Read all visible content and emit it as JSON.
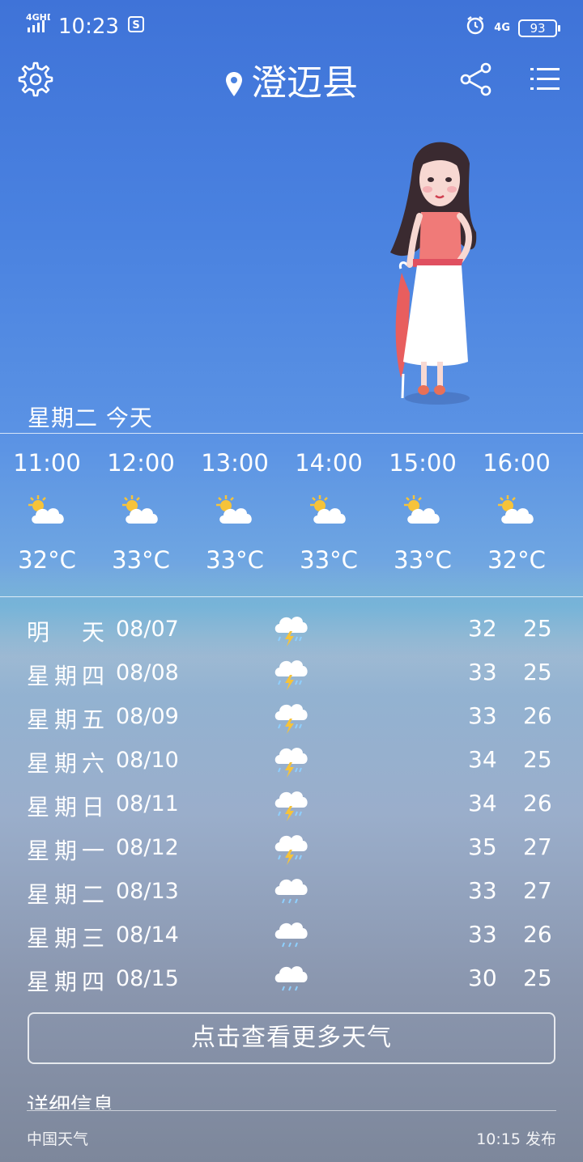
{
  "status_bar": {
    "network_label": "4GHD",
    "time": "10:23",
    "network_right": "4G",
    "battery": "93"
  },
  "header": {
    "city": "澄迈县"
  },
  "today_label": "星期二  今天",
  "hourly": [
    {
      "time": "11:00",
      "icon": "partly-cloudy-icon",
      "temp": "32°C"
    },
    {
      "time": "12:00",
      "icon": "partly-cloudy-icon",
      "temp": "33°C"
    },
    {
      "time": "13:00",
      "icon": "partly-cloudy-icon",
      "temp": "33°C"
    },
    {
      "time": "14:00",
      "icon": "partly-cloudy-icon",
      "temp": "33°C"
    },
    {
      "time": "15:00",
      "icon": "partly-cloudy-icon",
      "temp": "33°C"
    },
    {
      "time": "16:00",
      "icon": "partly-cloudy-icon",
      "temp": "32°C"
    }
  ],
  "daily": [
    {
      "day": "明天",
      "date": "08/07",
      "icon": "thunderstorm-icon",
      "high": "32",
      "low": "25"
    },
    {
      "day": "星期四",
      "date": "08/08",
      "icon": "thunderstorm-icon",
      "high": "33",
      "low": "25"
    },
    {
      "day": "星期五",
      "date": "08/09",
      "icon": "thunderstorm-icon",
      "high": "33",
      "low": "26"
    },
    {
      "day": "星期六",
      "date": "08/10",
      "icon": "thunderstorm-icon",
      "high": "34",
      "low": "25"
    },
    {
      "day": "星期日",
      "date": "08/11",
      "icon": "thunderstorm-icon",
      "high": "34",
      "low": "26"
    },
    {
      "day": "星期一",
      "date": "08/12",
      "icon": "thunderstorm-icon",
      "high": "35",
      "low": "27"
    },
    {
      "day": "星期二",
      "date": "08/13",
      "icon": "rain-icon",
      "high": "33",
      "low": "27"
    },
    {
      "day": "星期三",
      "date": "08/14",
      "icon": "rain-icon",
      "high": "33",
      "low": "26"
    },
    {
      "day": "星期四",
      "date": "08/15",
      "icon": "rain-icon",
      "high": "30",
      "low": "25"
    }
  ],
  "more_button": "点击查看更多天气",
  "detail_title": "详细信息",
  "footer": {
    "source": "中国天气",
    "published": "10:15 发布"
  }
}
